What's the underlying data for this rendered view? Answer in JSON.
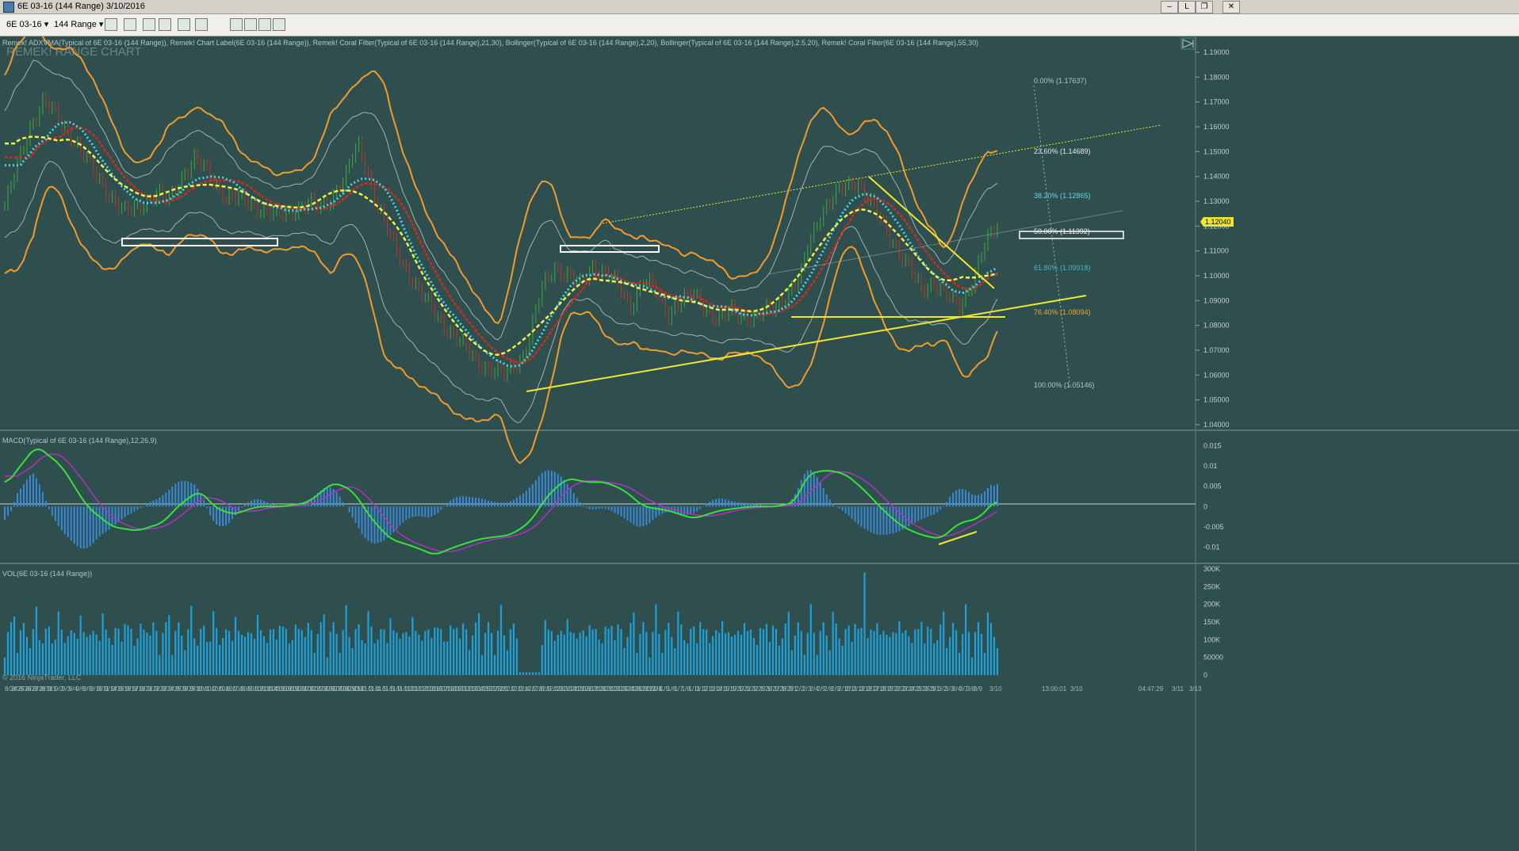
{
  "window": {
    "title": "6E 03-16 (144 Range)  3/10/2016",
    "buttons": [
      "–",
      "L",
      "❐",
      "✕"
    ]
  },
  "toolbar": {
    "instrument": "6E 03-16",
    "interval": "144 Range",
    "icons": [
      "bar-type-icon",
      "draw-tool-icon",
      "pen-icon",
      "wand-icon",
      "crosshair-icon",
      "zoom-icon",
      "properties-icon",
      "indicators-icon",
      "strategy-icon",
      "data-box-icon"
    ]
  },
  "panels": {
    "price": {
      "indicator_text": "Remek! ADXVMA(Typical of 6E 03-16 (144 Range)), Remek! Chart Label(6E 03-16 (144 Range)), Remek! Coral Filter(Typical of 6E 03-16 (144 Range),21,30), Bollinger(Typical of 6E 03-16 (144 Range),2,20), Bollinger(Typical of 6E 03-16 (144 Range),2.5,20), Remek! Coral Filter(6E 03-16 (144 Range),55,30)",
      "watermark": "REMEK! RANGE CHART",
      "price_badge": "1.12040",
      "fib_levels": [
        {
          "label": "0.00% (1.17637)",
          "color": "#b9c1c1"
        },
        {
          "label": "23.60% (1.14689)",
          "color": "#e8e8e8"
        },
        {
          "label": "38.20% (1.12865)",
          "color": "#63d4e6"
        },
        {
          "label": "50.00% (1.11392)",
          "color": "#f2f2f2"
        },
        {
          "label": "61.80% (1.09918)",
          "color": "#3fb8d0"
        },
        {
          "label": "76.40% (1.08094)",
          "color": "#f2a43a"
        },
        {
          "label": "100.00% (1.05146)",
          "color": "#b9c1c1"
        }
      ]
    },
    "macd": {
      "indicator_text": "MACD(Typical of 6E 03-16 (144 Range),12,26,9)"
    },
    "volume": {
      "indicator_text": "VOL(6E 03-16 (144 Range))",
      "copyright": "© 2016 NinjaTrader, LLC"
    }
  },
  "axis": {
    "price_ticks": [
      "1.19000",
      "1.18000",
      "1.17000",
      "1.16000",
      "1.15000",
      "1.14000",
      "1.13000",
      "1.12000",
      "1.11000",
      "1.10000",
      "1.09000",
      "1.08000",
      "1.07000",
      "1.06000",
      "1.05000",
      "1.04000"
    ],
    "macd_ticks": [
      "0.015",
      "0.01",
      "0.005",
      "0",
      "-0.005",
      "-0.01"
    ],
    "volume_ticks": [
      "300K",
      "250K",
      "200K",
      "150K",
      "100K",
      "50000",
      "0"
    ],
    "time_labels": [
      "8/24",
      "8/25",
      "8/26",
      "8/27",
      "8/28",
      "8/31",
      "9/1",
      "9/2",
      "9/3",
      "9/4",
      "9/8",
      "9/9",
      "9/10",
      "9/11",
      "9/14",
      "9/15",
      "9/16",
      "9/17",
      "9/18",
      "9/21",
      "9/22",
      "9/23",
      "9/24",
      "9/25",
      "9/28",
      "9/29",
      "9/30",
      "10/1",
      "10/2",
      "10/5",
      "10/6",
      "10/7",
      "10/8",
      "10/9",
      "10/12",
      "10/13",
      "10/14",
      "10/15",
      "10/16",
      "10/19",
      "10/20",
      "10/21",
      "10/22",
      "10/23",
      "10/26",
      "10/27",
      "10/28",
      "10/29",
      "10/30",
      "11/2",
      "11/3",
      "11/4",
      "11/5",
      "11/6",
      "11/9",
      "11/10",
      "11/11",
      "11/12",
      "11/13",
      "11/16",
      "11/17",
      "11/18",
      "11/19",
      "11/20",
      "11/23",
      "11/24",
      "11/25",
      "11/27",
      "11/30",
      "12/1",
      "12/2",
      "12/3",
      "12/4",
      "12/7",
      "12/8",
      "12/9",
      "12/10",
      "12/11",
      "12/14",
      "12/15",
      "12/16",
      "12/17",
      "12/18",
      "12/21",
      "12/22",
      "12/23",
      "12/24",
      "12/28",
      "12/29",
      "12/30",
      "12/31",
      "1/4",
      "1/5",
      "1/6",
      "1/7",
      "1/8",
      "1/11",
      "1/12",
      "1/13",
      "1/14",
      "1/15",
      "1/19",
      "1/20",
      "1/21",
      "1/22",
      "1/25",
      "1/26",
      "1/27",
      "1/28",
      "1/29",
      "2/1",
      "2/2",
      "2/3",
      "2/4",
      "2/5",
      "2/8",
      "2/9",
      "2/10",
      "2/11",
      "2/12",
      "2/16",
      "2/17",
      "2/18",
      "2/19",
      "2/22",
      "2/23",
      "2/24",
      "2/25",
      "2/26",
      "2/29",
      "3/1",
      "3/2",
      "3/3",
      "3/4",
      "3/7",
      "3/8",
      "3/9",
      "3/10",
      "13:00:01",
      "3/10",
      "04:47:29",
      "3/11",
      "3/13"
    ]
  },
  "colors": {
    "background": "#2f4f4f",
    "bollinger_outer": "#f29a2e",
    "bollinger_inner": "#c7c7c7",
    "coral_fast": "#46d4e8",
    "coral_slow": "#d42a1e",
    "adxvma": "#f2f24a",
    "trendline": "#f2e82a",
    "macd_line": "#3ae03a",
    "signal_line": "#b030c0",
    "histogram": "#3a8ad8",
    "volume": "#1ea0d8",
    "price_badge": "#f2e62a"
  },
  "chart_data": {
    "type": "candlestick",
    "price_axis": {
      "min": 1.04,
      "max": 1.19
    },
    "price_path": [
      [
        0,
        1.128
      ],
      [
        8,
        1.16
      ],
      [
        12,
        1.17
      ],
      [
        16,
        1.165
      ],
      [
        22,
        1.155
      ],
      [
        28,
        1.142
      ],
      [
        32,
        1.135
      ],
      [
        38,
        1.125
      ],
      [
        42,
        1.128
      ],
      [
        48,
        1.133
      ],
      [
        52,
        1.13
      ],
      [
        56,
        1.14
      ],
      [
        60,
        1.147
      ],
      [
        64,
        1.142
      ],
      [
        70,
        1.132
      ],
      [
        76,
        1.13
      ],
      [
        80,
        1.128
      ],
      [
        86,
        1.124
      ],
      [
        90,
        1.126
      ],
      [
        96,
        1.129
      ],
      [
        100,
        1.127
      ],
      [
        104,
        1.133
      ],
      [
        108,
        1.14
      ],
      [
        110,
        1.148
      ],
      [
        112,
        1.152
      ],
      [
        114,
        1.145
      ],
      [
        118,
        1.128
      ],
      [
        122,
        1.115
      ],
      [
        126,
        1.105
      ],
      [
        130,
        1.096
      ],
      [
        134,
        1.088
      ],
      [
        138,
        1.082
      ],
      [
        142,
        1.076
      ],
      [
        146,
        1.07
      ],
      [
        150,
        1.065
      ],
      [
        154,
        1.062
      ],
      [
        158,
        1.06
      ],
      [
        160,
        1.063
      ],
      [
        164,
        1.068
      ],
      [
        166,
        1.075
      ],
      [
        170,
        1.095
      ],
      [
        174,
        1.104
      ],
      [
        178,
        1.1
      ],
      [
        182,
        1.096
      ],
      [
        186,
        1.104
      ],
      [
        190,
        1.101
      ],
      [
        194,
        1.096
      ],
      [
        198,
        1.088
      ],
      [
        202,
        1.098
      ],
      [
        206,
        1.094
      ],
      [
        210,
        1.085
      ],
      [
        214,
        1.09
      ],
      [
        218,
        1.092
      ],
      [
        222,
        1.087
      ],
      [
        226,
        1.082
      ],
      [
        230,
        1.086
      ],
      [
        234,
        1.084
      ],
      [
        238,
        1.083
      ],
      [
        240,
        1.085
      ],
      [
        244,
        1.088
      ],
      [
        248,
        1.093
      ],
      [
        252,
        1.1
      ],
      [
        254,
        1.112
      ],
      [
        258,
        1.125
      ],
      [
        262,
        1.131
      ],
      [
        266,
        1.136
      ],
      [
        270,
        1.138
      ],
      [
        274,
        1.129
      ],
      [
        278,
        1.12
      ],
      [
        282,
        1.112
      ],
      [
        286,
        1.103
      ],
      [
        290,
        1.094
      ],
      [
        294,
        1.098
      ],
      [
        298,
        1.092
      ],
      [
        302,
        1.087
      ],
      [
        306,
        1.098
      ],
      [
        310,
        1.112
      ],
      [
        314,
        1.12
      ]
    ],
    "macd_axis": {
      "min": -0.013,
      "max": 0.017
    },
    "macd_path": [
      [
        0,
        0.005
      ],
      [
        10,
        0.015
      ],
      [
        18,
        0.01
      ],
      [
        26,
        0.0
      ],
      [
        34,
        -0.005
      ],
      [
        42,
        -0.006
      ],
      [
        50,
        -0.004
      ],
      [
        56,
        0.001
      ],
      [
        62,
        0.004
      ],
      [
        66,
        0.0
      ],
      [
        72,
        -0.002
      ],
      [
        80,
        0.0
      ],
      [
        88,
        0.0
      ],
      [
        96,
        0.001
      ],
      [
        104,
        0.006
      ],
      [
        110,
        0.004
      ],
      [
        116,
        -0.003
      ],
      [
        122,
        -0.008
      ],
      [
        130,
        -0.01
      ],
      [
        136,
        -0.012
      ],
      [
        142,
        -0.01
      ],
      [
        150,
        -0.008
      ],
      [
        160,
        -0.007
      ],
      [
        166,
        -0.004
      ],
      [
        172,
        0.003
      ],
      [
        178,
        0.007
      ],
      [
        184,
        0.006
      ],
      [
        190,
        0.006
      ],
      [
        196,
        0.004
      ],
      [
        202,
        0.0
      ],
      [
        210,
        -0.001
      ],
      [
        218,
        -0.003
      ],
      [
        226,
        -0.001
      ],
      [
        236,
        0.0
      ],
      [
        244,
        0.0
      ],
      [
        250,
        0.001
      ],
      [
        254,
        0.008
      ],
      [
        260,
        0.009
      ],
      [
        266,
        0.008
      ],
      [
        272,
        0.004
      ],
      [
        278,
        -0.001
      ],
      [
        284,
        -0.005
      ],
      [
        290,
        -0.007
      ],
      [
        296,
        -0.008
      ],
      [
        302,
        -0.004
      ],
      [
        308,
        -0.003
      ],
      [
        314,
        0.002
      ]
    ],
    "volume_axis": {
      "min": 0,
      "max": 300000
    }
  }
}
